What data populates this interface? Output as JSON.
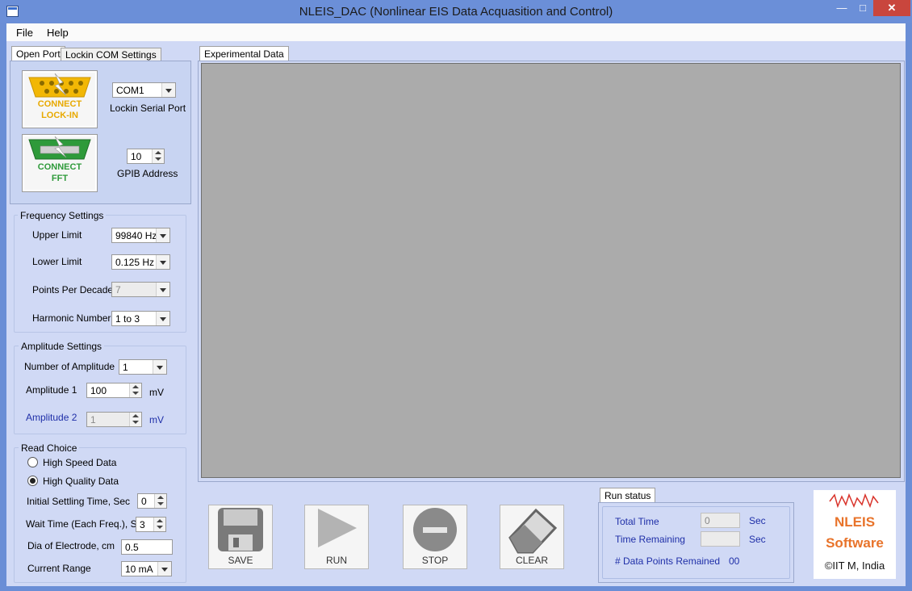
{
  "window": {
    "title": "NLEIS_DAC (Nonlinear EIS Data Acquasition and Control)",
    "min": "—",
    "max": "□",
    "close": "✕"
  },
  "menu": {
    "file": "File",
    "help": "Help"
  },
  "connect": {
    "tabs": [
      "Open Port",
      "Lockin COM Settings"
    ],
    "lockin_btn": [
      "CONNECT",
      "LOCK-IN"
    ],
    "fft_btn": [
      "CONNECT",
      "FFT"
    ],
    "serial_port": "COM1",
    "serial_port_label": "Lockin Serial Port",
    "gpib_address": "10",
    "gpib_label": "GPIB Address",
    "lockin_color": "#f2b705",
    "fft_color": "#2e9a3a"
  },
  "frequency": {
    "title": "Frequency Settings",
    "upper_label": "Upper Limit",
    "upper_value": "99840 Hz",
    "lower_label": "Lower Limit",
    "lower_value": "0.125 Hz",
    "ppd_label": "Points Per Decade",
    "ppd_value": "7",
    "harmonic_label": "Harmonic Number",
    "harmonic_value": "1 to 3"
  },
  "amplitude": {
    "title": "Amplitude Settings",
    "num_label": "Number of Amplitude",
    "num_value": "1",
    "a1_label": "Amplitude 1",
    "a1_value": "100",
    "a1_unit": "mV",
    "a2_label": "Amplitude 2",
    "a2_value": "1",
    "a2_unit": "mV"
  },
  "read": {
    "title": "Read Choice",
    "high_speed": "High Speed Data",
    "high_quality": "High Quality Data",
    "selected": "high_quality",
    "settling_label": "Initial Settling Time, Sec",
    "settling_value": "0",
    "wait_label": "Wait Time (Each Freq.), Sec",
    "wait_value": "3",
    "dia_label": "Dia of Electrode, cm",
    "dia_value": "0.5",
    "range_label": "Current Range",
    "range_value": "10 mA"
  },
  "experimental": {
    "tab": "Experimental Data"
  },
  "actions": {
    "save": "SAVE",
    "run": "RUN",
    "stop": "STOP",
    "clear": "CLEAR"
  },
  "run_status": {
    "tab": "Run status",
    "total_label": "Total Time",
    "total_value": "0",
    "total_unit": "Sec",
    "remaining_label": "Time Remaining",
    "remaining_value": "",
    "remaining_unit": "Sec",
    "points_label": "# Data Points Remained",
    "points_value": "00"
  },
  "logo": {
    "line1": "NLEIS",
    "line2": "Software",
    "credit": "©IIT M, India",
    "color": "#e8732a"
  }
}
